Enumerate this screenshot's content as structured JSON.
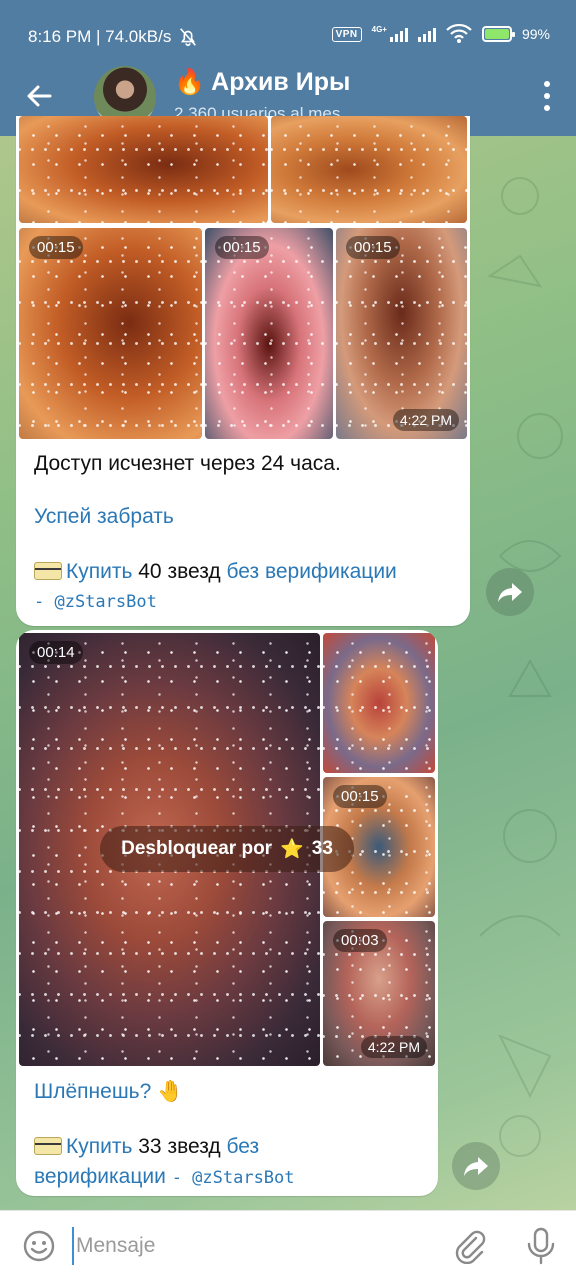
{
  "status_bar": {
    "time_speed": "8:16 PM | 74.0kB/s",
    "vpn": "VPN",
    "network": "4G+",
    "battery_percent": "99%",
    "battery_level": 0.99
  },
  "header": {
    "title": "Архив Иры",
    "title_emoji": "🔥",
    "subtitle": "2,360 usuarios al mes",
    "icons": [
      "arrow-back-icon",
      "avatar",
      "more-vertical-icon"
    ]
  },
  "message1": {
    "durations": [
      "00:15",
      "00:15",
      "00:15"
    ],
    "time": "4:22 PM",
    "text": "Доступ исчезнет через 24 часа.",
    "link": "Успей забрать",
    "buy_prefix": "Купить",
    "buy_amount": "40 звезд",
    "buy_suffix": "без верификации",
    "bot": "- @zStarsBot"
  },
  "message2": {
    "durations": [
      "00:14",
      "00:15",
      "00:03"
    ],
    "time": "4:22 PM",
    "unlock_label": "Desbloquear por",
    "unlock_star": "⭐",
    "unlock_price": "33",
    "text_link": "Шлёпнешь?",
    "text_emoji": "🤚",
    "buy_prefix": "Купить",
    "buy_amount": "33 звезд",
    "buy_suffix_line1": "без",
    "buy_suffix_line2": "верификации",
    "bot": "- @zStarsBot"
  },
  "input": {
    "placeholder": "Mensaje"
  }
}
